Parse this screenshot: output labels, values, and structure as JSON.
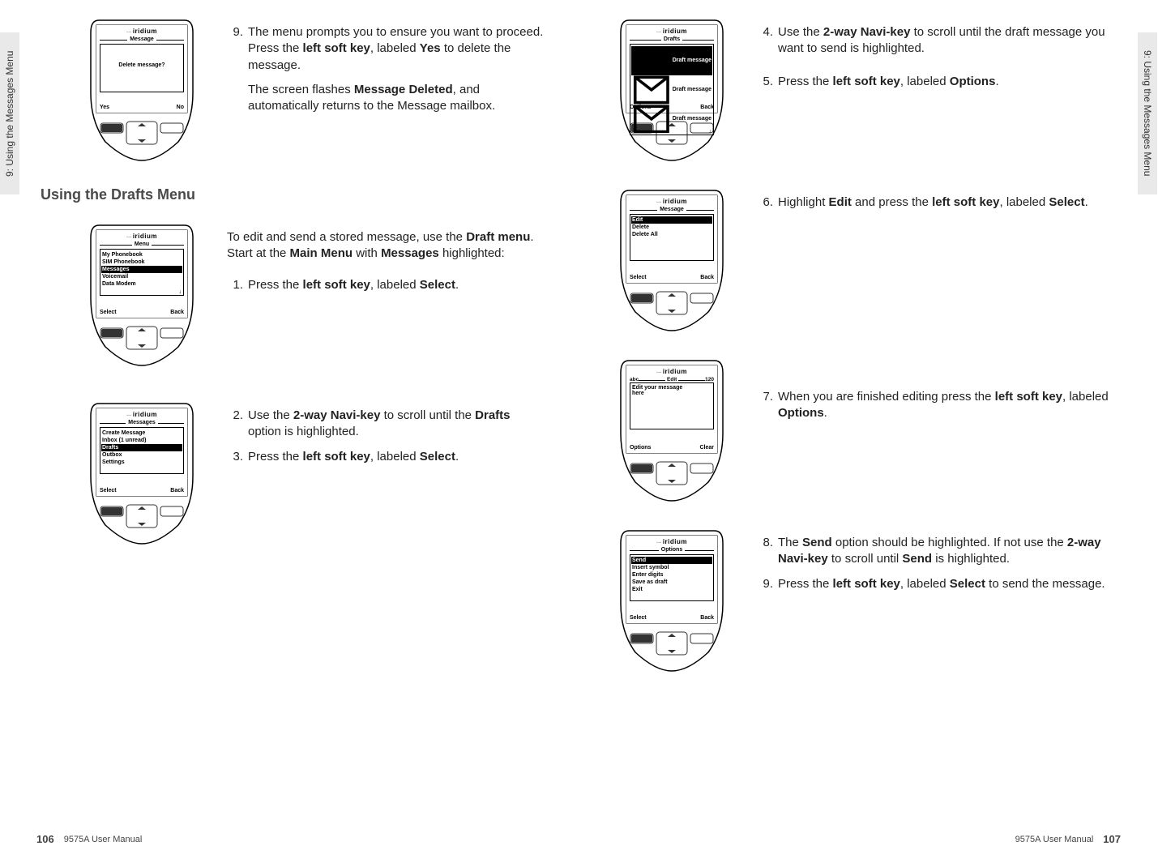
{
  "meta": {
    "side_tab_left": "9: Using the Messages Menu",
    "side_tab_right": "9: Using the Messages Menu",
    "footer_doc": "9575A User Manual",
    "page_left": "106",
    "page_right": "107"
  },
  "brand": "iridium",
  "left": {
    "screen1": {
      "title": "Message",
      "prompt": "Delete message?",
      "sk_left": "Yes",
      "sk_right": "No"
    },
    "step9a": "The menu prompts you to ensure you want to proceed. Press the ",
    "step9b": "left soft key",
    "step9c": ", labeled ",
    "step9d": "Yes",
    "step9e": " to delete the message.",
    "step9f": "The screen flashes ",
    "step9g": "Message Deleted",
    "step9h": ", and automatically returns to the Message mailbox.",
    "section": "Using the Drafts Menu",
    "intro1": "To edit and send a stored message, use the ",
    "intro2": "Draft menu",
    "intro3": ". Start at the ",
    "intro4": "Main Menu",
    "intro5": " with ",
    "intro6": "Messages",
    "intro7": " highlighted:",
    "screen2": {
      "title": "Menu",
      "items": [
        "My Phonebook",
        "SIM Phonebook",
        "Messages",
        "Voicemail",
        "Data Modem"
      ],
      "hl_index": 2,
      "sk_left": "Select",
      "sk_right": "Back"
    },
    "step1a": "Press the ",
    "step1b": "left soft key",
    "step1c": ", labeled ",
    "step1d": "Select",
    "step1e": ".",
    "screen3": {
      "title": "Messages",
      "items": [
        "Create Message",
        "Inbox (1 unread)",
        "Drafts",
        "Outbox",
        "Settings"
      ],
      "hl_index": 2,
      "sk_left": "Select",
      "sk_right": "Back"
    },
    "step2a": "Use the ",
    "step2b": "2-way Navi-key",
    "step2c": " to scroll until the ",
    "step2d": "Drafts",
    "step2e": " option is highlighted.",
    "step3a": "Press the ",
    "step3b": "left soft key",
    "step3c": ", labeled ",
    "step3d": "Select",
    "step3e": "."
  },
  "right": {
    "screen4": {
      "title": "Drafts",
      "items": [
        "Draft message",
        "Draft message",
        "Draft message"
      ],
      "hl_index": 0,
      "sk_left": "Options",
      "sk_right": "Back"
    },
    "step4a": "Use the ",
    "step4b": "2-way Navi-key",
    "step4c": " to scroll until the draft message you want to send is highlighted.",
    "step5a": "Press the ",
    "step5b": "left soft key",
    "step5c": ", labeled ",
    "step5d": "Options",
    "step5e": ".",
    "screen5": {
      "title": "Message",
      "items": [
        "Edit",
        "Delete",
        "Delete All"
      ],
      "hl_index": 0,
      "sk_left": "Select",
      "sk_right": "Back"
    },
    "step6a": "Highlight ",
    "step6b": "Edit",
    "step6c": " and press the ",
    "step6d": "left soft key",
    "step6e": ", labeled ",
    "step6f": "Select",
    "step6g": ".",
    "screen6": {
      "mode": "abc",
      "title": "Edit",
      "count": "120",
      "text1": "Edit your message",
      "text2": "here",
      "sk_left": "Options",
      "sk_right": "Clear"
    },
    "step7a": "When you are finished editing press the ",
    "step7b": "left soft key",
    "step7c": ", labeled ",
    "step7d": "Options",
    "step7e": ".",
    "screen7": {
      "title": "Options",
      "items": [
        "Send",
        "Insert symbol",
        "Enter digits",
        "Save as draft",
        "Exit"
      ],
      "hl_index": 0,
      "sk_left": "Select",
      "sk_right": "Back"
    },
    "step8a": "The ",
    "step8b": "Send",
    "step8c": " option should be highlighted. If not use the ",
    "step8d": "2-way Navi-key",
    "step8e": " to scroll until ",
    "step8f": "Send",
    "step8g": " is highlighted.",
    "step9a": "Press the ",
    "step9b": "left soft key",
    "step9c": ", labeled ",
    "step9d": "Select",
    "step9e": " to send the message."
  }
}
